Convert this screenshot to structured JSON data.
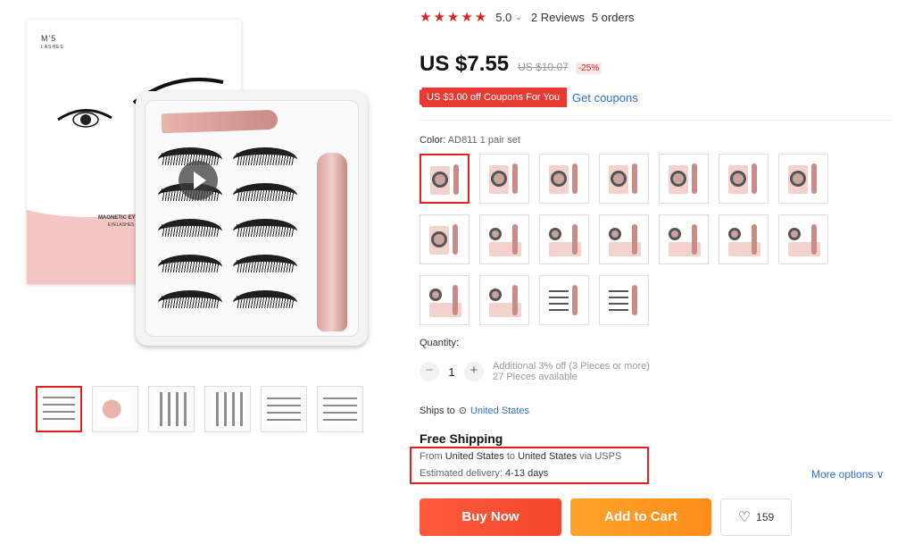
{
  "gallery": {
    "brand_name": "M'5",
    "brand_sub": "LASHES",
    "box_text": "MAGNETIC EYELASHES AND E",
    "box_subtext": "EYELASHES • MAGNETIC EY"
  },
  "rating": {
    "stars": "★★★★★",
    "score": "5.0",
    "reviews": "2 Reviews",
    "orders": "5 orders"
  },
  "price": {
    "current": "US $7.55",
    "original": "US $10.07",
    "discount": "-25%"
  },
  "coupon": {
    "tag": "US $3.00 off Coupons For You",
    "link": "Get coupons"
  },
  "color": {
    "label": "Color:",
    "value": "AD811 1 pair set"
  },
  "quantity": {
    "label": "Quantity:",
    "value": "1",
    "minus": "−",
    "plus": "+",
    "note1": "Additional 3% off (3 Pieces or more)",
    "note2": "27 Pieces available"
  },
  "shipping": {
    "ships_to_label": "Ships to",
    "country": "United States",
    "free_label": "Free Shipping",
    "from_prefix": "From",
    "from_country": "United States",
    "to_word": "to",
    "to_country": "United States",
    "via": "via USPS",
    "delivery_label": "Estimated delivery:",
    "delivery_days": "4-13 days",
    "more_options": "More options ∨"
  },
  "actions": {
    "buy_now": "Buy Now",
    "add_to_cart": "Add to Cart",
    "wishlist_count": "159"
  },
  "colors": {
    "accent_red": "#e02020",
    "buy_orange": "#f2472b",
    "cart_orange": "#ff8c1a",
    "link_blue": "#2e6fd1"
  }
}
